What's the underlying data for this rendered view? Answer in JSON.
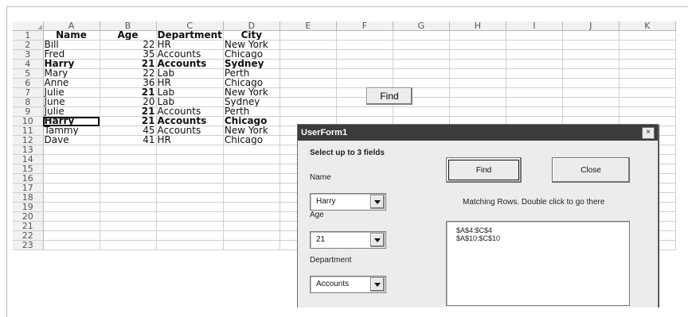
{
  "columns": [
    "A",
    "B",
    "C",
    "D",
    "E",
    "F",
    "G",
    "H",
    "I",
    "J",
    "K"
  ],
  "rows": [
    {
      "n": "1",
      "bold": true,
      "cells": [
        "Name",
        "Age",
        "Department",
        "City"
      ]
    },
    {
      "n": "2",
      "bold": false,
      "cells": [
        "Bill",
        "22",
        "HR",
        "New York"
      ]
    },
    {
      "n": "3",
      "bold": false,
      "cells": [
        "Fred",
        "35",
        "Accounts",
        "Chicago"
      ]
    },
    {
      "n": "4",
      "bold": true,
      "cells": [
        "Harry",
        "21",
        "Accounts",
        "Sydney"
      ]
    },
    {
      "n": "5",
      "bold": false,
      "cells": [
        "Mary",
        "22",
        "Lab",
        "Perth"
      ]
    },
    {
      "n": "6",
      "bold": false,
      "cells": [
        "Anne",
        "36",
        "HR",
        "Chicago"
      ]
    },
    {
      "n": "7",
      "bold": false,
      "cells": [
        "Julie",
        "21",
        "Lab",
        "New York"
      ],
      "bold_age": true
    },
    {
      "n": "8",
      "bold": false,
      "cells": [
        "June",
        "20",
        "Lab",
        "Sydney"
      ]
    },
    {
      "n": "9",
      "bold": false,
      "cells": [
        "Julie",
        "21",
        "Accounts",
        "Perth"
      ],
      "bold_age": true
    },
    {
      "n": "10",
      "bold": true,
      "cells": [
        "Harry",
        "21",
        "Accounts",
        "Chicago"
      ]
    },
    {
      "n": "11",
      "bold": false,
      "cells": [
        "Tammy",
        "45",
        "Accounts",
        "New York"
      ]
    },
    {
      "n": "12",
      "bold": false,
      "cells": [
        "Dave",
        "41",
        "HR",
        "Chicago"
      ]
    },
    {
      "n": "13",
      "bold": false,
      "cells": [
        "",
        "",
        "",
        ""
      ]
    },
    {
      "n": "14",
      "bold": false,
      "cells": [
        "",
        "",
        "",
        ""
      ]
    },
    {
      "n": "15",
      "bold": false,
      "cells": [
        "",
        "",
        "",
        ""
      ]
    },
    {
      "n": "16",
      "bold": false,
      "cells": [
        "",
        "",
        "",
        ""
      ]
    },
    {
      "n": "17",
      "bold": false,
      "cells": [
        "",
        "",
        "",
        ""
      ]
    },
    {
      "n": "18",
      "bold": false,
      "cells": [
        "",
        "",
        "",
        ""
      ]
    },
    {
      "n": "19",
      "bold": false,
      "cells": [
        "",
        "",
        "",
        ""
      ]
    },
    {
      "n": "20",
      "bold": false,
      "cells": [
        "",
        "",
        "",
        ""
      ]
    },
    {
      "n": "21",
      "bold": false,
      "cells": [
        "",
        "",
        "",
        ""
      ]
    },
    {
      "n": "22",
      "bold": false,
      "cells": [
        "",
        "",
        "",
        ""
      ]
    },
    {
      "n": "23",
      "bold": false,
      "cells": [
        "",
        "",
        "",
        ""
      ]
    }
  ],
  "active_cell": "A10",
  "sheet_find_label": "Find",
  "userform": {
    "title": "UserForm1",
    "close_glyph": "×",
    "heading": "Select up to 3 fields",
    "name_label": "Name",
    "name_value": "Harry",
    "age_label": "Age",
    "age_value": "21",
    "department_label": "Department",
    "department_value": "Accounts",
    "find_label": "Find",
    "close_label": "Close",
    "results_label": "Matching Rows. Double click to go there",
    "results": [
      "$A$4:$C$4",
      "$A$10:$C$10"
    ]
  },
  "colors": {
    "titlebar": "#3b3b3b",
    "form_bg": "#ececec",
    "header_bg": "#f1f1f1",
    "gridline": "#d0d0d0"
  }
}
